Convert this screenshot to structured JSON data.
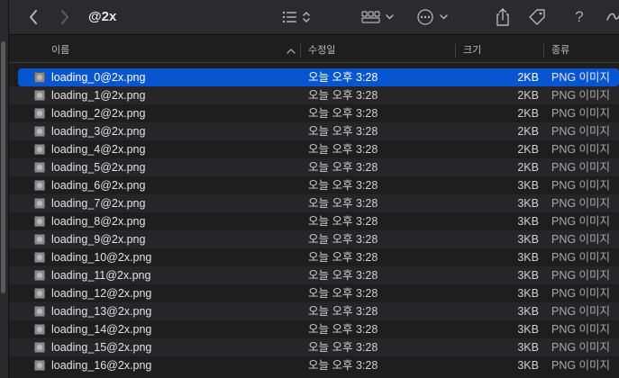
{
  "window": {
    "title": "@2x"
  },
  "toolbar": {
    "back_icon": "chevron-left-icon",
    "forward_icon": "chevron-right-icon",
    "view_list_icon": "list-view-icon",
    "group_icon": "grid-group-icon",
    "action_icon": "ellipsis-circle-icon",
    "share_icon": "share-icon",
    "tag_icon": "tag-icon",
    "help_label": "?",
    "more_icon": "more-icon"
  },
  "columns": {
    "name": "이름",
    "date": "수정일",
    "size": "크기",
    "kind": "종류"
  },
  "colors": {
    "selection": "#0856cf",
    "background": "#1e1e1e",
    "toolbar": "#2b2b2d"
  },
  "files": [
    {
      "name": "loading_0@2x.png",
      "date": "오늘 오후 3:28",
      "size": "2KB",
      "kind": "PNG 이미지",
      "selected": true
    },
    {
      "name": "loading_1@2x.png",
      "date": "오늘 오후 3:28",
      "size": "2KB",
      "kind": "PNG 이미지"
    },
    {
      "name": "loading_2@2x.png",
      "date": "오늘 오후 3:28",
      "size": "2KB",
      "kind": "PNG 이미지"
    },
    {
      "name": "loading_3@2x.png",
      "date": "오늘 오후 3:28",
      "size": "2KB",
      "kind": "PNG 이미지"
    },
    {
      "name": "loading_4@2x.png",
      "date": "오늘 오후 3:28",
      "size": "2KB",
      "kind": "PNG 이미지"
    },
    {
      "name": "loading_5@2x.png",
      "date": "오늘 오후 3:28",
      "size": "2KB",
      "kind": "PNG 이미지"
    },
    {
      "name": "loading_6@2x.png",
      "date": "오늘 오후 3:28",
      "size": "3KB",
      "kind": "PNG 이미지"
    },
    {
      "name": "loading_7@2x.png",
      "date": "오늘 오후 3:28",
      "size": "3KB",
      "kind": "PNG 이미지"
    },
    {
      "name": "loading_8@2x.png",
      "date": "오늘 오후 3:28",
      "size": "3KB",
      "kind": "PNG 이미지"
    },
    {
      "name": "loading_9@2x.png",
      "date": "오늘 오후 3:28",
      "size": "3KB",
      "kind": "PNG 이미지"
    },
    {
      "name": "loading_10@2x.png",
      "date": "오늘 오후 3:28",
      "size": "3KB",
      "kind": "PNG 이미지"
    },
    {
      "name": "loading_11@2x.png",
      "date": "오늘 오후 3:28",
      "size": "3KB",
      "kind": "PNG 이미지"
    },
    {
      "name": "loading_12@2x.png",
      "date": "오늘 오후 3:28",
      "size": "3KB",
      "kind": "PNG 이미지"
    },
    {
      "name": "loading_13@2x.png",
      "date": "오늘 오후 3:28",
      "size": "3KB",
      "kind": "PNG 이미지"
    },
    {
      "name": "loading_14@2x.png",
      "date": "오늘 오후 3:28",
      "size": "3KB",
      "kind": "PNG 이미지"
    },
    {
      "name": "loading_15@2x.png",
      "date": "오늘 오후 3:28",
      "size": "3KB",
      "kind": "PNG 이미지"
    },
    {
      "name": "loading_16@2x.png",
      "date": "오늘 오후 3:28",
      "size": "3KB",
      "kind": "PNG 이미지"
    }
  ]
}
